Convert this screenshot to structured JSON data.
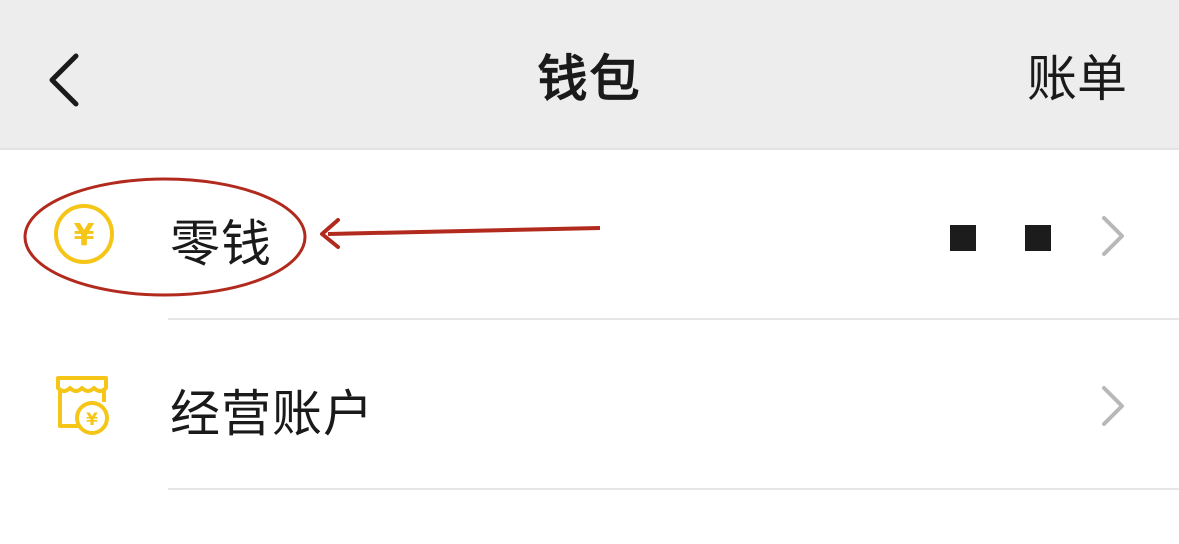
{
  "header": {
    "title": "钱包",
    "right_action": "账单"
  },
  "rows": [
    {
      "label": "零钱",
      "icon": "yuan-coin-icon",
      "value": "■ ■"
    },
    {
      "label": "经营账户",
      "icon": "store-yuan-icon"
    }
  ],
  "colors": {
    "header_bg": "#ededed",
    "icon_yellow": "#f5c518",
    "annotation_red": "#b22a1e",
    "chevron_gray": "#b8b8b8"
  }
}
